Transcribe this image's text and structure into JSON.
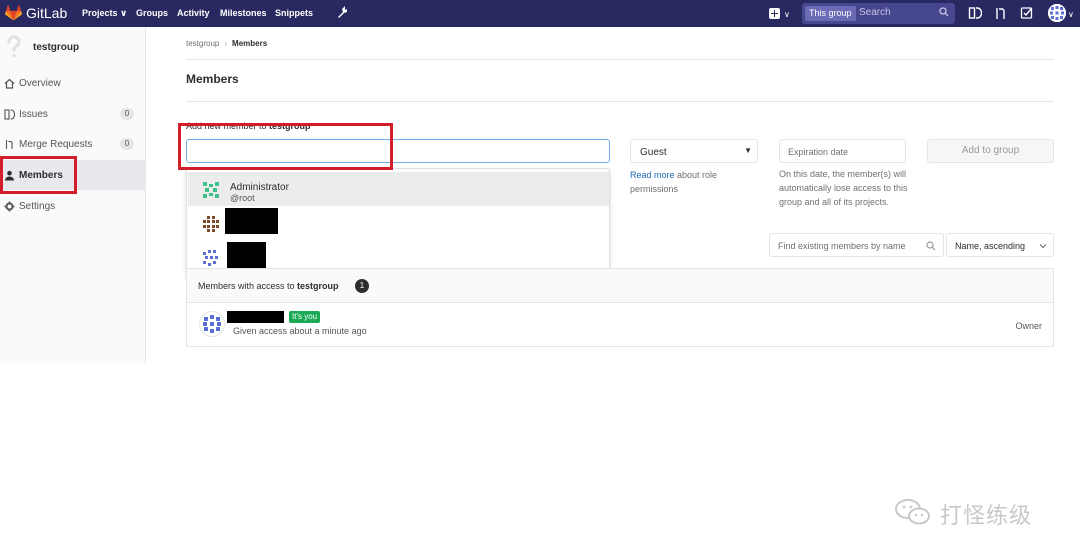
{
  "topbar": {
    "brand": "GitLab",
    "nav": [
      "Projects ∨",
      "Groups",
      "Activity",
      "Milestones",
      "Snippets"
    ],
    "search_scope": "This group",
    "search_placeholder": "Search",
    "colors": {
      "bar": "#292961",
      "logo": "#e24329"
    }
  },
  "sidebar": {
    "group_name": "testgroup",
    "items": [
      {
        "label": "Overview",
        "icon": "home-icon"
      },
      {
        "label": "Issues",
        "icon": "issues-icon",
        "count": "0"
      },
      {
        "label": "Merge Requests",
        "icon": "merge-request-icon",
        "count": "0"
      },
      {
        "label": "Members",
        "icon": "user-icon",
        "active": true
      },
      {
        "label": "Settings",
        "icon": "gear-icon"
      }
    ]
  },
  "breadcrumb": {
    "parent": "testgroup",
    "separator": "›",
    "current": "Members"
  },
  "page_title": "Members",
  "add_member": {
    "label_prefix": "Add new member to ",
    "label_group": "testgroup",
    "input_value": "",
    "suggestions": [
      {
        "name": "Administrator",
        "username": "@root"
      }
    ]
  },
  "role": {
    "selected": "Guest",
    "help_link": "Read more",
    "help_text": " about role permissions"
  },
  "expiration": {
    "placeholder": "Expiration date",
    "help": "On this date, the member(s) will automatically lose access to this group and all of its projects."
  },
  "add_button": "Add to group",
  "filter": {
    "placeholder": "Find existing members by name",
    "sort": "Name, ascending"
  },
  "members_panel": {
    "heading_prefix": "Members with access to ",
    "heading_group": "testgroup",
    "count": "1",
    "member": {
      "badge": "It's you",
      "given": "Given access about a minute ago",
      "role": "Owner"
    }
  },
  "watermark": "打怪练级"
}
